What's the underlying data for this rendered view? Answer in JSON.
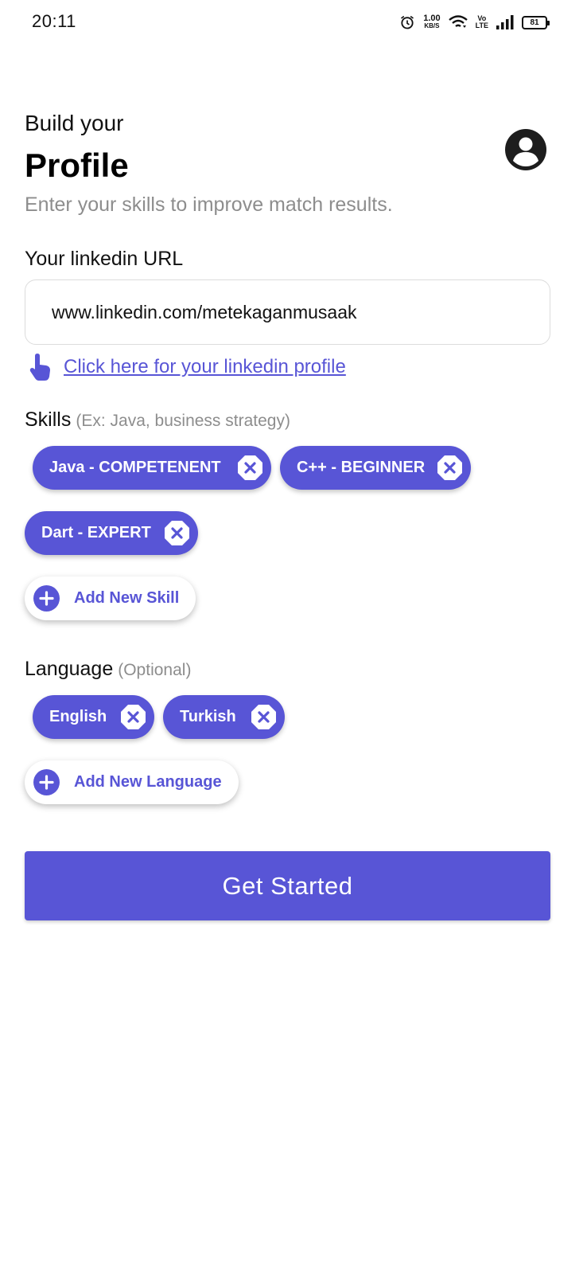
{
  "status_bar": {
    "time": "20:11",
    "speed_value": "1.00",
    "speed_unit": "KB/S",
    "volte_top": "Vo",
    "volte_bottom": "LTE",
    "battery": "81"
  },
  "header": {
    "subtitle": "Build your",
    "title": "Profile",
    "description": "Enter your skills to improve match results.",
    "avatar_icon": "account-circle-icon"
  },
  "linkedin": {
    "label": "Your linkedin URL",
    "value": "www.linkedin.com/metekaganmusaak",
    "link_text": "Click here for your linkedin profile",
    "link_icon": "hand-pointer-icon"
  },
  "skills": {
    "label": "Skills",
    "hint": "(Ex: Java, business strategy)",
    "items": [
      {
        "label": "Java - COMPETENENT"
      },
      {
        "label": "C++ - BEGINNER"
      },
      {
        "label": "Dart - EXPERT"
      }
    ],
    "add_label": "Add New Skill"
  },
  "language": {
    "label": "Language",
    "hint": "(Optional)",
    "items": [
      {
        "label": "English"
      },
      {
        "label": "Turkish"
      }
    ],
    "add_label": "Add New Language"
  },
  "cta_label": "Get Started",
  "colors": {
    "accent": "#5855d6",
    "muted_text": "#8d8d8d"
  }
}
